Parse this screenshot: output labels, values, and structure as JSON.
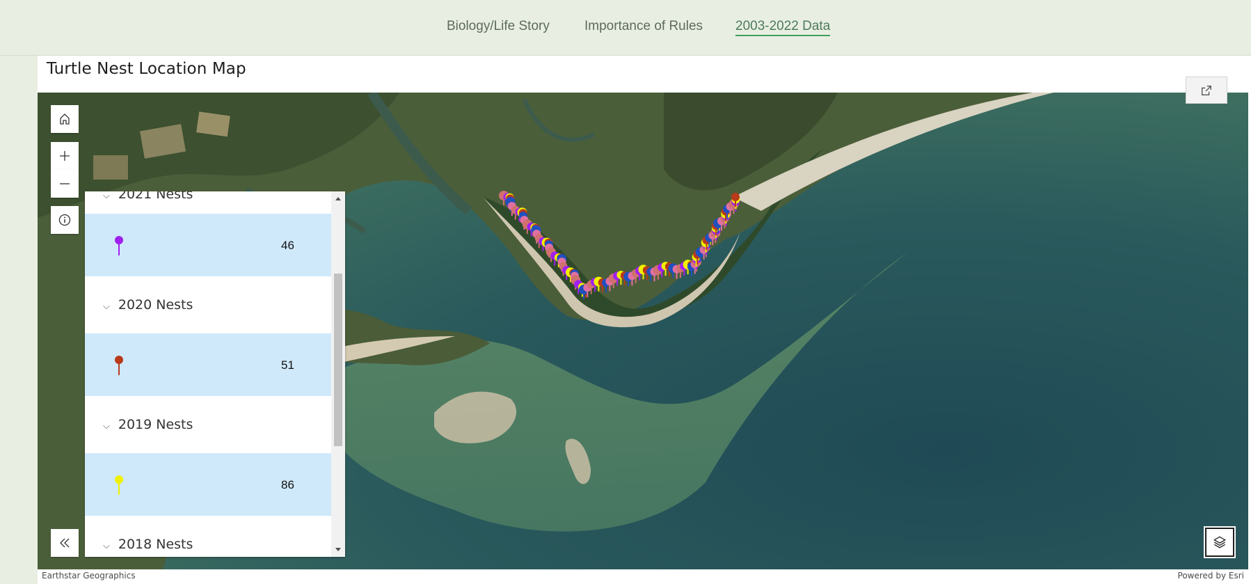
{
  "nav": {
    "items": [
      {
        "label": "Biology/Life Story"
      },
      {
        "label": "Importance of Rules"
      },
      {
        "label": "2003-2022 Data"
      }
    ],
    "active_index": 2
  },
  "page": {
    "title": "Turtle Nest Location Map"
  },
  "map": {
    "widgets": {
      "home": "home-icon",
      "zoom_in": "plus-icon",
      "zoom_out": "minus-icon",
      "info": "info-icon",
      "collapse": "double-chevron-left-icon",
      "layers": "layers-icon",
      "open_external": "open-external-icon"
    },
    "attribution_left": "Earthstar Geographics",
    "attribution_right": "Powered by Esri"
  },
  "legend": {
    "groups": [
      {
        "label": "2021 Nests",
        "count": "46",
        "color": "#a020f0"
      },
      {
        "label": "2020 Nests",
        "count": "51",
        "color": "#b83a1a"
      },
      {
        "label": "2019 Nests",
        "count": "86",
        "color": "#f0f000"
      },
      {
        "label": "2018 Nests",
        "count": "",
        "color": ""
      }
    ]
  },
  "colors": {
    "nav_bg": "#e8efe2",
    "nav_active": "#3f9e5a",
    "legend_row": "#cfe9fb",
    "nest_pink": "#d07070"
  }
}
